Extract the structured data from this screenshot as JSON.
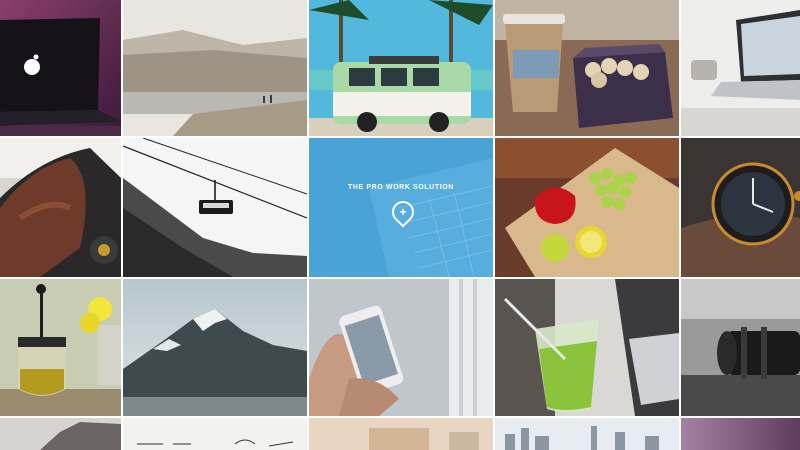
{
  "gallery": {
    "feature_tile": {
      "caption": "THE PRO WORK SOLUTION",
      "badge_icon": "plus-icon",
      "accent": "#4aa3d6"
    },
    "tiles": [
      {
        "subject": "laptop-apple-logo"
      },
      {
        "subject": "misty-lake"
      },
      {
        "subject": "camper-van-palms"
      },
      {
        "subject": "coffee-cup-macarons"
      },
      {
        "subject": "laptop-desk"
      },
      {
        "subject": "leather-glove-steering-wheel"
      },
      {
        "subject": "cable-car-mountain"
      },
      {
        "subject": "pro-work-solution"
      },
      {
        "subject": "pepper-grapes-lime"
      },
      {
        "subject": "wristwatch"
      },
      {
        "subject": "french-press-flowers"
      },
      {
        "subject": "snowy-mountain"
      },
      {
        "subject": "smartphone-in-hand"
      },
      {
        "subject": "mojito-laptop"
      },
      {
        "subject": "camera-lens"
      },
      {
        "subject": "city-rooftop"
      },
      {
        "subject": "sketch-icons"
      },
      {
        "subject": "blurred-interior"
      },
      {
        "subject": "city-skyline"
      },
      {
        "subject": "purple-gradient"
      }
    ]
  }
}
